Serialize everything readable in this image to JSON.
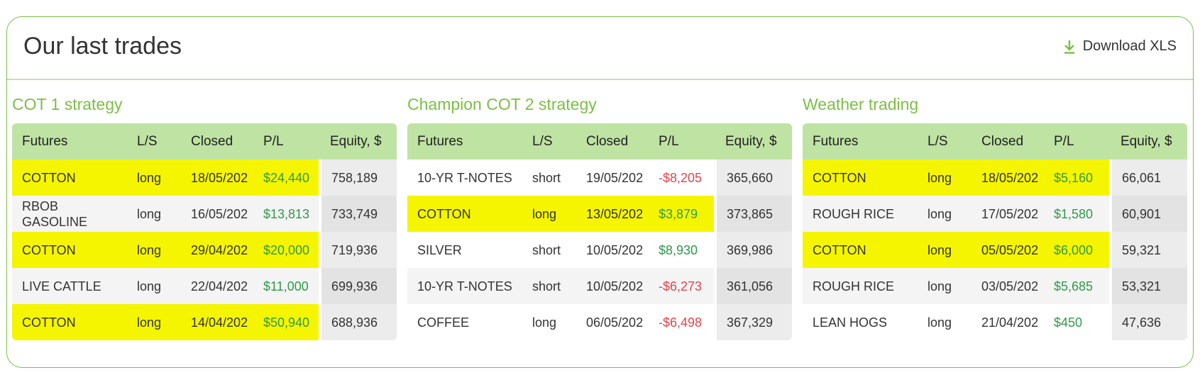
{
  "header": {
    "title": "Our last trades",
    "download_label": "Download XLS",
    "download_icon": "download-arrow-icon"
  },
  "colors": {
    "accent": "#7cbf44",
    "table_header": "#bfe3a3",
    "highlight": "#f5f500",
    "positive": "#2e9a4a",
    "negative": "#e0464f"
  },
  "columns": [
    "Futures",
    "L/S",
    "Closed",
    "P/L",
    "Equity, $"
  ],
  "strategies": [
    {
      "title": "COT 1 strategy",
      "rows": [
        {
          "futures": "COTTON",
          "ls": "long",
          "closed": "18/05/202",
          "pl": "$24,440",
          "pl_sign": "pos",
          "equity": "758,189",
          "highlight": true
        },
        {
          "futures": "RBOB GASOLINE",
          "ls": "long",
          "closed": "16/05/202",
          "pl": "$13,813",
          "pl_sign": "pos",
          "equity": "733,749",
          "highlight": false
        },
        {
          "futures": "COTTON",
          "ls": "long",
          "closed": "29/04/202",
          "pl": "$20,000",
          "pl_sign": "pos",
          "equity": "719,936",
          "highlight": true
        },
        {
          "futures": "LIVE CATTLE",
          "ls": "long",
          "closed": "22/04/202",
          "pl": "$11,000",
          "pl_sign": "pos",
          "equity": "699,936",
          "highlight": false
        },
        {
          "futures": "COTTON",
          "ls": "long",
          "closed": "14/04/202",
          "pl": "$50,940",
          "pl_sign": "pos",
          "equity": "688,936",
          "highlight": true
        }
      ]
    },
    {
      "title": "Champion COT 2 strategy",
      "rows": [
        {
          "futures": "10-YR T-NOTES",
          "ls": "short",
          "closed": "19/05/202",
          "pl": "-$8,205",
          "pl_sign": "neg",
          "equity": "365,660",
          "highlight": false
        },
        {
          "futures": "COTTON",
          "ls": "long",
          "closed": "13/05/202",
          "pl": "$3,879",
          "pl_sign": "pos",
          "equity": "373,865",
          "highlight": true
        },
        {
          "futures": "SILVER",
          "ls": "short",
          "closed": "10/05/202",
          "pl": "$8,930",
          "pl_sign": "pos",
          "equity": "369,986",
          "highlight": false
        },
        {
          "futures": "10-YR T-NOTES",
          "ls": "short",
          "closed": "10/05/202",
          "pl": "-$6,273",
          "pl_sign": "neg",
          "equity": "361,056",
          "highlight": false
        },
        {
          "futures": "COFFEE",
          "ls": "long",
          "closed": "06/05/202",
          "pl": "-$6,498",
          "pl_sign": "neg",
          "equity": "367,329",
          "highlight": false
        }
      ]
    },
    {
      "title": "Weather trading",
      "rows": [
        {
          "futures": "COTTON",
          "ls": "long",
          "closed": "18/05/202",
          "pl": "$5,160",
          "pl_sign": "pos",
          "equity": "66,061",
          "highlight": true
        },
        {
          "futures": "ROUGH RICE",
          "ls": "long",
          "closed": "17/05/202",
          "pl": "$1,580",
          "pl_sign": "pos",
          "equity": "60,901",
          "highlight": false
        },
        {
          "futures": "COTTON",
          "ls": "long",
          "closed": "05/05/202",
          "pl": "$6,000",
          "pl_sign": "pos",
          "equity": "59,321",
          "highlight": true
        },
        {
          "futures": "ROUGH RICE",
          "ls": "long",
          "closed": "03/05/202",
          "pl": "$5,685",
          "pl_sign": "pos",
          "equity": "53,321",
          "highlight": false
        },
        {
          "futures": "LEAN HOGS",
          "ls": "long",
          "closed": "21/04/202",
          "pl": "$450",
          "pl_sign": "pos",
          "equity": "47,636",
          "highlight": false
        }
      ]
    }
  ]
}
